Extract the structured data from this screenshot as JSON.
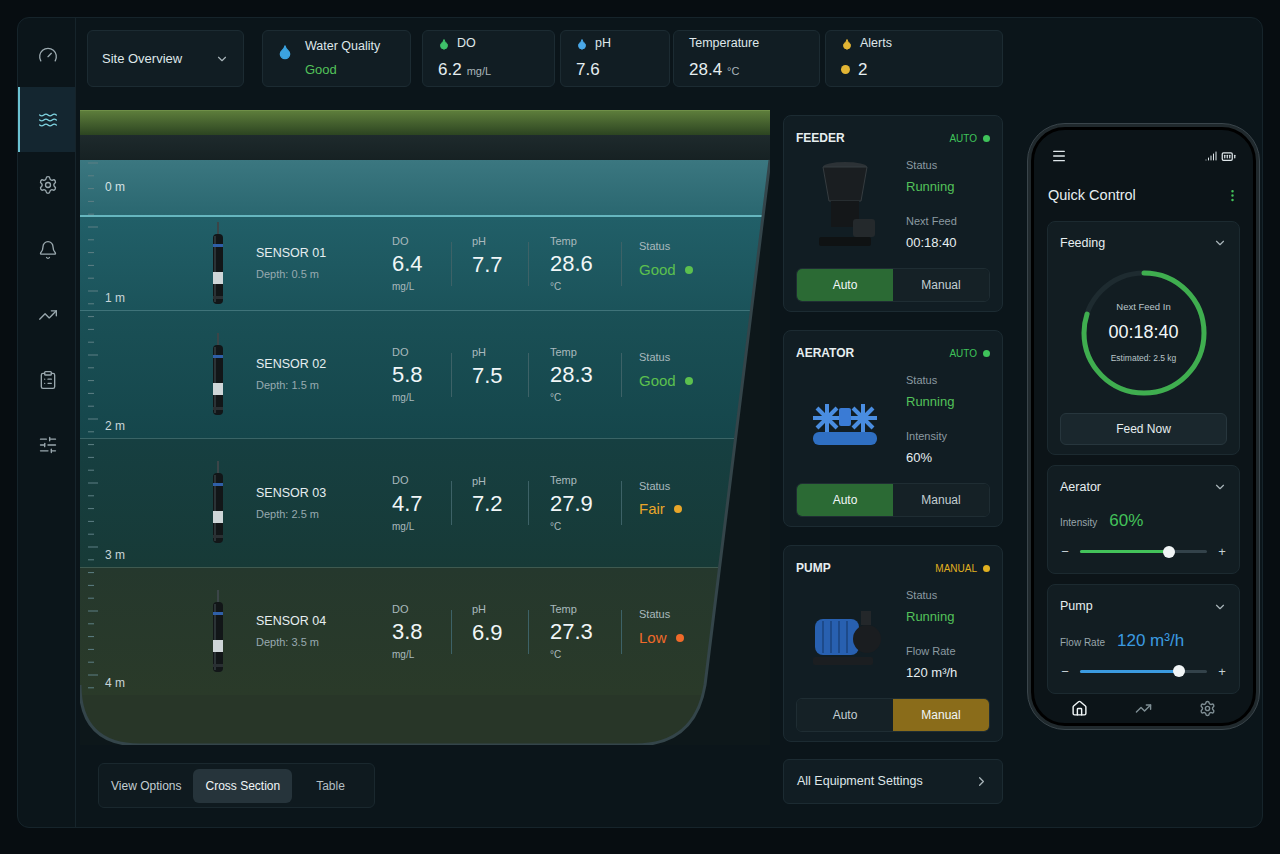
{
  "sidebar": {
    "items": [
      {
        "selected": false
      },
      {
        "selected": true
      },
      {
        "selected": false
      },
      {
        "selected": false
      },
      {
        "selected": false
      },
      {
        "selected": false
      },
      {
        "selected": false
      }
    ]
  },
  "site_selector": {
    "label": "Site Overview"
  },
  "summary": [
    {
      "kind": "quality",
      "label": "Water Quality",
      "value": "Good",
      "unit": "",
      "color": "#3ba3e0",
      "value_color": "#53c25a"
    },
    {
      "kind": "metric",
      "label": "DO",
      "value": "6.2",
      "unit": "mg/L",
      "color": "#3fc06a",
      "value_color": "#e6eef0"
    },
    {
      "kind": "metric",
      "label": "pH",
      "value": "7.6",
      "unit": "",
      "color": "#4aa8e8",
      "value_color": "#e6eef0"
    },
    {
      "kind": "plain",
      "label": "Temperature",
      "value": "28.4",
      "unit": "°C",
      "color": "#e6eef0",
      "value_color": "#e6eef0"
    },
    {
      "kind": "alert",
      "label": "Alerts",
      "value": "2",
      "unit": "",
      "color": "#e2b534",
      "value_color": "#e6eef0"
    }
  ],
  "pond": {
    "depth_marks": [
      "0 m",
      "1 m",
      "2 m",
      "3 m",
      "4 m"
    ],
    "labels": {
      "do": "DO",
      "ph": "pH",
      "temp": "Temp",
      "status": "Status"
    },
    "sensors": [
      {
        "name": "SENSOR 01",
        "depth": "Depth: 0.5 m",
        "do": "6.4",
        "do_unit": "mg/L",
        "ph": "7.7",
        "temp": "28.6",
        "temp_unit": "°C",
        "status": "Good",
        "color": "#5cc04e"
      },
      {
        "name": "SENSOR 02",
        "depth": "Depth: 1.5 m",
        "do": "5.8",
        "do_unit": "mg/L",
        "ph": "7.5",
        "temp": "28.3",
        "temp_unit": "°C",
        "status": "Good",
        "color": "#5cc04e"
      },
      {
        "name": "SENSOR 03",
        "depth": "Depth: 2.5 m",
        "do": "4.7",
        "do_unit": "mg/L",
        "ph": "7.2",
        "temp": "27.9",
        "temp_unit": "°C",
        "status": "Fair",
        "color": "#e8a62a"
      },
      {
        "name": "SENSOR 04",
        "depth": "Depth: 3.5 m",
        "do": "3.8",
        "do_unit": "mg/L",
        "ph": "6.9",
        "temp": "27.3",
        "temp_unit": "°C",
        "status": "Low",
        "color": "#f06a2a"
      }
    ]
  },
  "view_options": {
    "label": "View Options",
    "options": [
      {
        "label": "Cross Section",
        "selected": true
      },
      {
        "label": "Table",
        "selected": false
      }
    ]
  },
  "equipment": [
    {
      "kind": "feeder",
      "name": "FEEDER",
      "mode": "AUTO",
      "mode_color": "#3fc35a",
      "status_label": "Status",
      "status": "Running",
      "detail_label": "Next Feed",
      "detail": "00:18:40",
      "buttons": [
        {
          "label": "Auto",
          "selected": true,
          "color": "#2b6a34"
        },
        {
          "label": "Manual",
          "selected": false,
          "color": "#8a6c1a"
        }
      ]
    },
    {
      "kind": "aerator",
      "name": "AERATOR",
      "mode": "AUTO",
      "mode_color": "#3fc35a",
      "status_label": "Status",
      "status": "Running",
      "detail_label": "Intensity",
      "detail": "60%",
      "buttons": [
        {
          "label": "Auto",
          "selected": true,
          "color": "#2b6a34"
        },
        {
          "label": "Manual",
          "selected": false,
          "color": "#8a6c1a"
        }
      ]
    },
    {
      "kind": "pump",
      "name": "PUMP",
      "mode": "MANUAL",
      "mode_color": "#e0b020",
      "status_label": "Status",
      "status": "Running",
      "detail_label": "Flow Rate",
      "detail": "120 m³/h",
      "buttons": [
        {
          "label": "Auto",
          "selected": false,
          "color": "#2b6a34"
        },
        {
          "label": "Manual",
          "selected": true,
          "color": "#8a6c1a"
        }
      ]
    }
  ],
  "all_settings": {
    "label": "All Equipment Settings"
  },
  "phone": {
    "title": "Quick Control",
    "feeding": {
      "title": "Feeding",
      "expanded": true,
      "caption": "Next Feed In",
      "time": "00:18:40",
      "estimate": "Estimated: 2.5 kg",
      "level": 0.8,
      "button": "Feed Now"
    },
    "controls": [
      {
        "title": "Aerator",
        "expanded": true,
        "label": "Intensity",
        "value": "60%",
        "level": 0.7,
        "color": "#43c25a",
        "minus": "−",
        "plus": "+"
      },
      {
        "title": "Pump",
        "expanded": true,
        "label": "Flow Rate",
        "value": "120 m³/h",
        "level": 0.78,
        "color": "#3b9be0",
        "minus": "−",
        "plus": "+"
      }
    ],
    "nav": [
      {
        "selected": true
      },
      {
        "selected": false
      },
      {
        "selected": false
      }
    ]
  }
}
